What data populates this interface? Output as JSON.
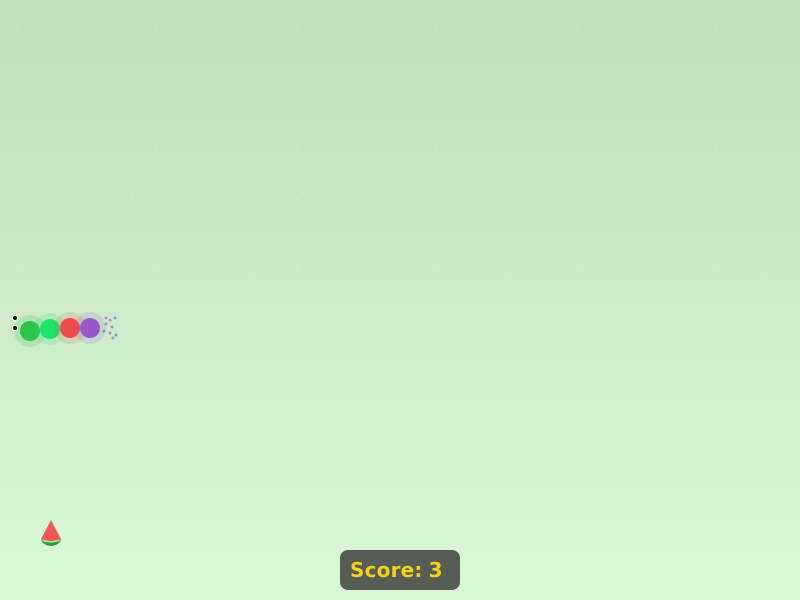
{
  "game": {
    "score_label": "Score:",
    "score_value": "3"
  },
  "colors": {
    "head": "#2cc44b",
    "body_green": "#1ee56d",
    "body_red": "#f04b4b",
    "body_purple": "#9b59c8",
    "score_bg": "#565d55",
    "score_text": "#f3d019"
  },
  "icons": {
    "food": "watermelon-slice-icon"
  }
}
